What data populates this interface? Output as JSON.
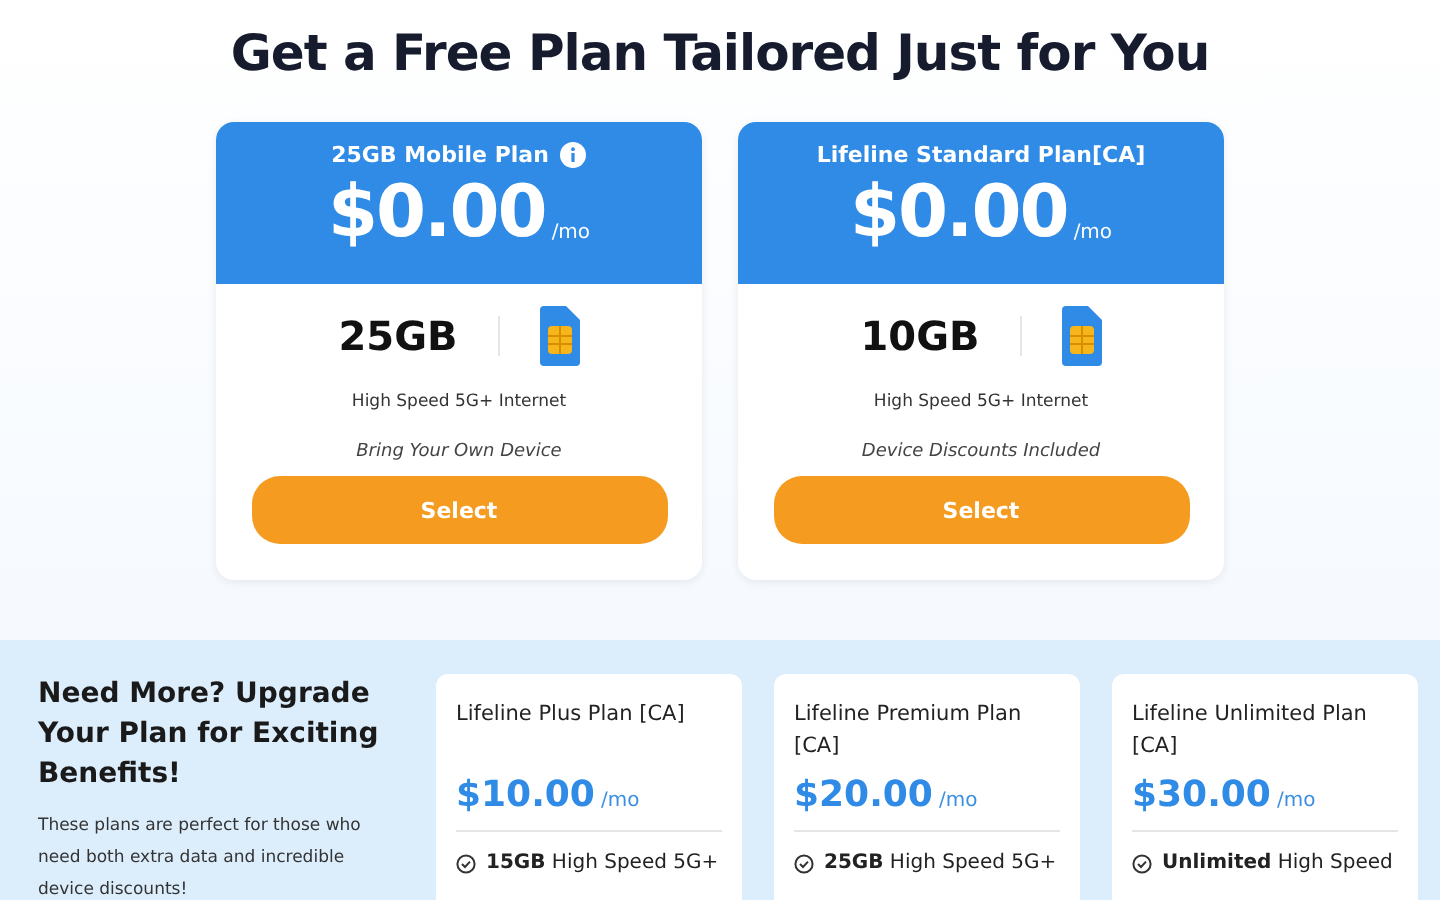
{
  "heading": "Get a Free Plan Tailored Just for You",
  "free_plans": [
    {
      "name": "25GB Mobile Plan",
      "info_icon": true,
      "price": "$0.00",
      "period": "/mo",
      "data": "25GB",
      "speed": "High Speed 5G+ Internet",
      "note": "Bring Your Own Device",
      "button": "Select"
    },
    {
      "name": "Lifeline Standard Plan[CA]",
      "info_icon": false,
      "price": "$0.00",
      "period": "/mo",
      "data": "10GB",
      "speed": "High Speed 5G+ Internet",
      "note": "Device Discounts Included",
      "button": "Select"
    }
  ],
  "upgrade": {
    "title": "Need More? Upgrade Your Plan for Exciting Benefits!",
    "text": "These plans are perfect for those who need both extra data and incredible device discounts!",
    "plans": [
      {
        "name": "Lifeline Plus Plan [CA]",
        "price": "$10.00",
        "period": "/mo",
        "feature": "**15GB** High Speed 5G+"
      },
      {
        "name": "Lifeline Premium Plan [CA]",
        "price": "$20.00",
        "period": "/mo",
        "feature": "**25GB** High Speed 5G+"
      },
      {
        "name": "Lifeline Unlimited Plan [CA]",
        "price": "$30.00",
        "period": "/mo",
        "feature": "**Unlimited** High Speed"
      }
    ]
  }
}
